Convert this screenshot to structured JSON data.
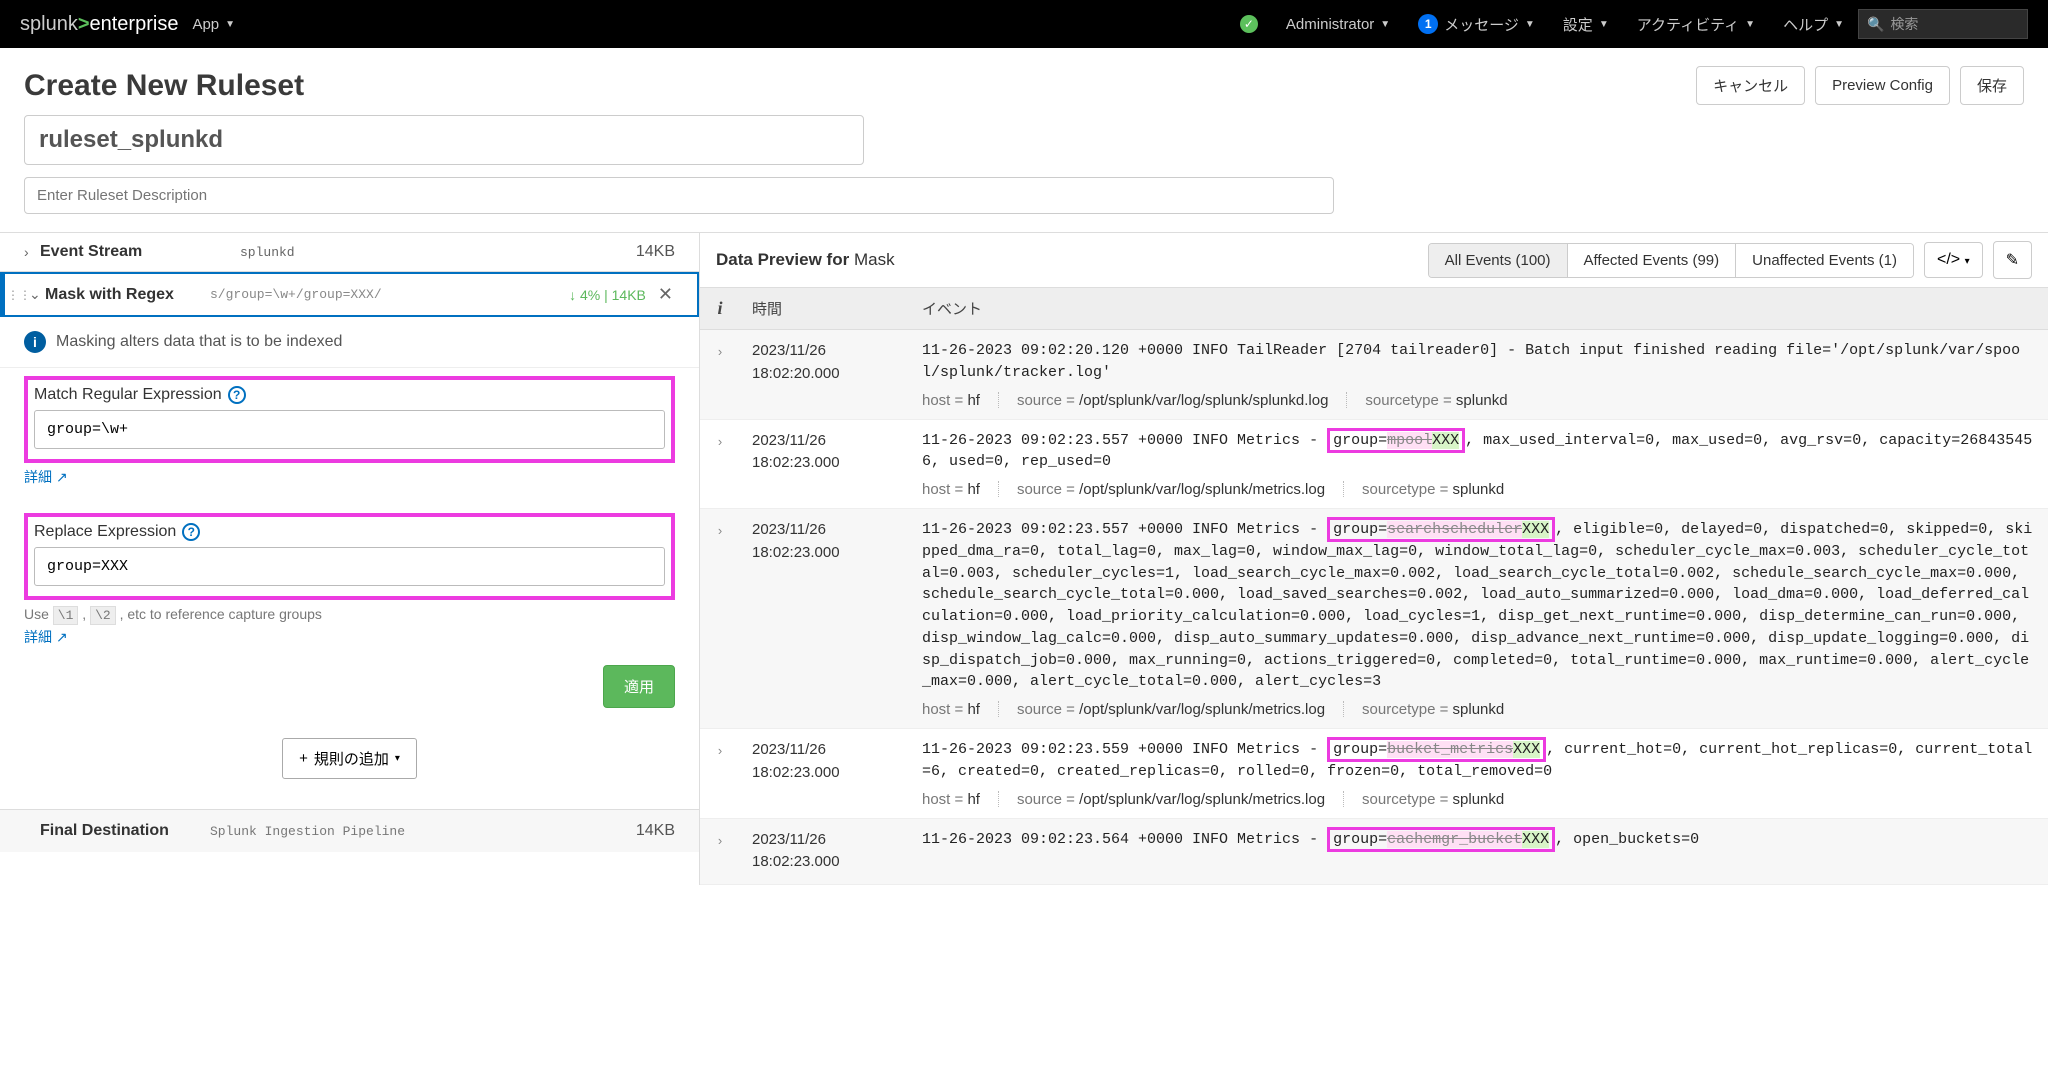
{
  "topbar": {
    "app_label": "App",
    "admin": "Administrator",
    "messages": "メッセージ",
    "messages_count": "1",
    "settings": "設定",
    "activity": "アクティビティ",
    "help": "ヘルプ",
    "search_placeholder": "検索"
  },
  "header": {
    "title": "Create New Ruleset",
    "cancel": "キャンセル",
    "preview": "Preview Config",
    "save": "保存"
  },
  "ruleset": {
    "name": "ruleset_splunkd",
    "desc_placeholder": "Enter Ruleset Description"
  },
  "event_stream": {
    "label": "Event Stream",
    "source": "splunkd",
    "size": "14KB"
  },
  "rule": {
    "label": "Mask with Regex",
    "summary": "s/group=\\w+/group=XXX/",
    "delta": "↓ 4% | 14KB"
  },
  "info": {
    "text": "Masking alters data that is to be indexed"
  },
  "form": {
    "match_label": "Match Regular Expression",
    "match_value": "group=\\w+",
    "replace_label": "Replace Expression",
    "replace_value": "group=XXX",
    "replace_hint_prefix": "Use ",
    "replace_hint_code1": "\\1",
    "replace_hint_code2": "\\2",
    "replace_hint_suffix": " , etc to reference capture groups",
    "details": "詳細",
    "apply": "適用",
    "add_rule": "規則の追加"
  },
  "final": {
    "label": "Final Destination",
    "value": "Splunk Ingestion Pipeline",
    "size": "14KB"
  },
  "preview": {
    "title_prefix": "Data Preview for ",
    "title_rule": "Mask",
    "tab_all": "All Events (100)",
    "tab_affected": "Affected Events (99)",
    "tab_unaffected": "Unaffected Events (1)"
  },
  "table": {
    "col_time": "時間",
    "col_event": "イベント",
    "meta_host_label": "host = ",
    "meta_source_label": "source = ",
    "meta_sourcetype_label": "sourcetype = "
  },
  "events": [
    {
      "date": "2023/11/26",
      "time": "18:02:20.000",
      "raw_prefix": "11-26-2023 09:02:20.120 +0000 INFO  TailReader [2704 tailreader0] - Batch input finished reading file='/opt/splunk/var/spool/splunk/tracker.log'",
      "mask": "",
      "xxx": "",
      "raw_suffix": "",
      "host": "hf",
      "source": "/opt/splunk/var/log/splunk/splunkd.log",
      "sourcetype": "splunkd"
    },
    {
      "date": "2023/11/26",
      "time": "18:02:23.000",
      "raw_prefix": "11-26-2023 09:02:23.557 +0000 INFO  Metrics - ",
      "mask": "mpool",
      "xxx": "XXX",
      "raw_suffix": ", max_used_interval=0, max_used=0, avg_rsv=0, capacity=268435456, used=0, rep_used=0",
      "host": "hf",
      "source": "/opt/splunk/var/log/splunk/metrics.log",
      "sourcetype": "splunkd"
    },
    {
      "date": "2023/11/26",
      "time": "18:02:23.000",
      "raw_prefix": "11-26-2023 09:02:23.557 +0000 INFO  Metrics - ",
      "mask": "searchscheduler",
      "xxx": "XXX",
      "raw_suffix": ", eligible=0, delayed=0, dispatched=0, skipped=0, skipped_dma_ra=0, total_lag=0, max_lag=0, window_max_lag=0, window_total_lag=0, scheduler_cycle_max=0.003, scheduler_cycle_total=0.003, scheduler_cycles=1, load_search_cycle_max=0.002, load_search_cycle_total=0.002, schedule_search_cycle_max=0.000, schedule_search_cycle_total=0.000, load_saved_searches=0.002, load_auto_summarized=0.000, load_dma=0.000, load_deferred_calculation=0.000, load_priority_calculation=0.000, load_cycles=1, disp_get_next_runtime=0.000, disp_determine_can_run=0.000, disp_window_lag_calc=0.000, disp_auto_summary_updates=0.000, disp_advance_next_runtime=0.000, disp_update_logging=0.000, disp_dispatch_job=0.000, max_running=0, actions_triggered=0, completed=0, total_runtime=0.000, max_runtime=0.000, alert_cycle_max=0.000, alert_cycle_total=0.000, alert_cycles=3",
      "host": "hf",
      "source": "/opt/splunk/var/log/splunk/metrics.log",
      "sourcetype": "splunkd"
    },
    {
      "date": "2023/11/26",
      "time": "18:02:23.000",
      "raw_prefix": "11-26-2023 09:02:23.559 +0000 INFO  Metrics - ",
      "mask": "bucket_metrics",
      "xxx": "XXX",
      "raw_suffix": ", current_hot=0, current_hot_replicas=0, current_total=6, created=0, created_replicas=0, rolled=0, frozen=0, total_removed=0",
      "host": "hf",
      "source": "/opt/splunk/var/log/splunk/metrics.log",
      "sourcetype": "splunkd"
    },
    {
      "date": "2023/11/26",
      "time": "18:02:23.000",
      "raw_prefix": "11-26-2023 09:02:23.564 +0000 INFO  Metrics - ",
      "mask": "cachemgr_bucket",
      "xxx": "XXX",
      "raw_suffix": ", open_buckets=0",
      "host": "hf",
      "source": "/opt/splunk/var/log/splunk/metrics.log",
      "sourcetype": "splunkd"
    }
  ]
}
